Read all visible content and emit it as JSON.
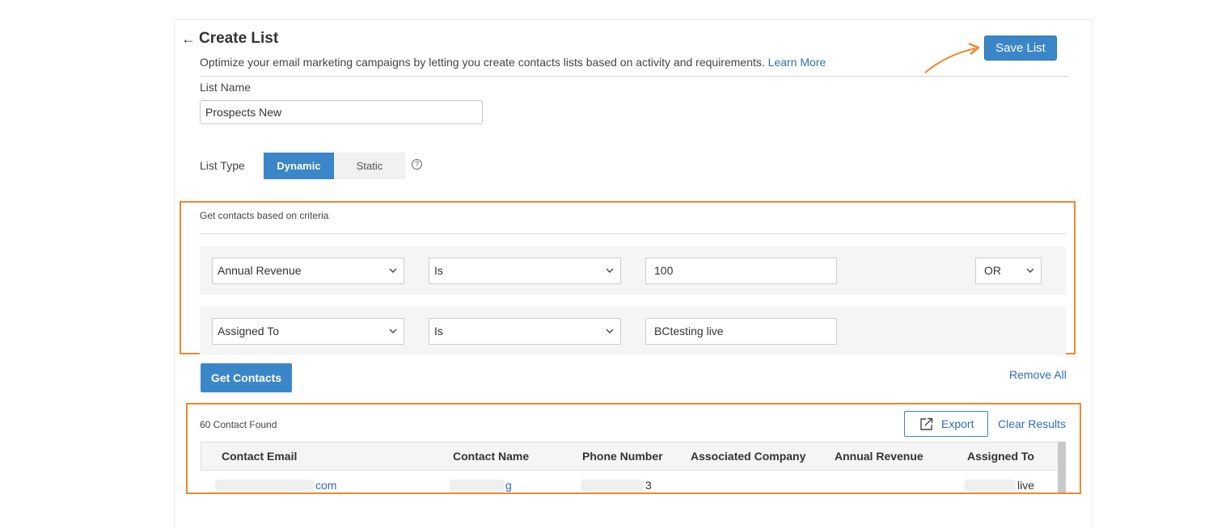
{
  "header": {
    "back_icon": "arrow-left-icon",
    "title": "Create List",
    "subtitle": "Optimize your email marketing campaigns by letting you create contacts lists based on activity and requirements.",
    "learn_more": "Learn More",
    "save_label": "Save List"
  },
  "form": {
    "list_name_label": "List Name",
    "list_name_value": "Prospects New",
    "list_type_label": "List Type",
    "list_type_options": [
      "Dynamic",
      "Static"
    ],
    "list_type_selected": "Dynamic",
    "help_icon": "?"
  },
  "criteria": {
    "title": "Get contacts based on criteria",
    "rows": [
      {
        "field": "Annual Revenue",
        "operator": "Is",
        "value": "100",
        "join": "OR"
      },
      {
        "field": "Assigned To",
        "operator": "Is",
        "value": "BCtesting live"
      }
    ],
    "get_contacts_label": "Get Contacts",
    "remove_all_label": "Remove All"
  },
  "results": {
    "count_text": "60 Contact Found",
    "export_label": "Export",
    "clear_label": "Clear Results",
    "columns": [
      "Contact Email",
      "Contact Name",
      "Phone Number",
      "Associated Company",
      "Annual Revenue",
      "Assigned To"
    ],
    "rows": [
      {
        "email_visible": "com",
        "name_visible": "g",
        "phone_visible": "3",
        "company": "",
        "revenue": "",
        "assigned_visible": "live"
      }
    ]
  },
  "colors": {
    "accent": "#3a86c8",
    "link": "#2f6fb3",
    "highlight": "#f0882a"
  }
}
